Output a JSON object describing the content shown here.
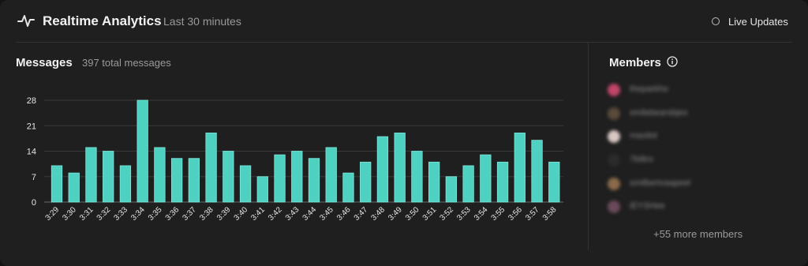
{
  "header": {
    "title": "Realtime Analytics",
    "subtitle": "Last 30 minutes",
    "icon": "activity-icon",
    "live_updates_label": "Live Updates"
  },
  "messages": {
    "title": "Messages",
    "subtitle": "397 total messages"
  },
  "chart_data": {
    "type": "bar",
    "title": "",
    "xlabel": "",
    "ylabel": "",
    "ylim": [
      0,
      28
    ],
    "yticks": [
      0,
      7,
      14,
      21,
      28
    ],
    "grid": true,
    "color": "#4fd1c2",
    "categories": [
      "3:29",
      "3:30",
      "3:31",
      "3:32",
      "3:33",
      "3:34",
      "3:35",
      "3:36",
      "3:37",
      "3:38",
      "3:39",
      "3:40",
      "3:41",
      "3:42",
      "3:43",
      "3:44",
      "3:45",
      "3:46",
      "3:47",
      "3:48",
      "3:49",
      "3:50",
      "3:51",
      "3:52",
      "3:53",
      "3:54",
      "3:55",
      "3:56",
      "3:57",
      "3:58"
    ],
    "values": [
      10,
      8,
      15,
      14,
      10,
      28,
      15,
      12,
      12,
      19,
      14,
      10,
      7,
      13,
      14,
      12,
      15,
      8,
      11,
      18,
      19,
      14,
      11,
      7,
      10,
      13,
      11,
      19,
      17,
      11
    ]
  },
  "members": {
    "title": "Members",
    "info_icon": "info-icon",
    "list": [
      {
        "name": "theparkho",
        "avatar_color": "#c2456a"
      },
      {
        "name": "smilebearsbjes",
        "avatar_color": "#5a4a3a"
      },
      {
        "name": "maxilot",
        "avatar_color": "#d9c7c4"
      },
      {
        "name": "7biltro",
        "avatar_color": "#2b2b2b"
      },
      {
        "name": "smilbertvaapeel",
        "avatar_color": "#8a6a4a"
      },
      {
        "name": "iEYSHee",
        "avatar_color": "#6a4a5a"
      }
    ],
    "more_label": "+55 more members"
  }
}
